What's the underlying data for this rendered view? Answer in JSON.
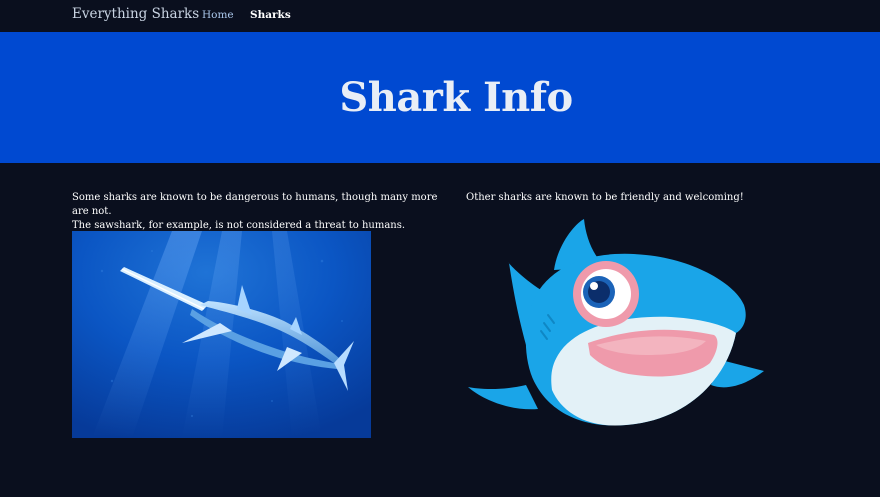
{
  "nav": {
    "brand": "Everything Sharks",
    "links": [
      {
        "label": "Home"
      },
      {
        "label": "Sharks"
      }
    ]
  },
  "hero": {
    "title": "Shark Info"
  },
  "content": {
    "left_text_line1": "Some sharks are known to be dangerous to humans, though many more are not.",
    "left_text_line2": "The sawshark, for example, is not considered a threat to humans.",
    "right_text": "Other sharks are known to be friendly and welcoming!"
  },
  "colors": {
    "page_background": "#0a0f1e",
    "hero_background": "#0049d1",
    "cartoon_shark": "#1aa5e8",
    "cartoon_belly": "#e3f1f7",
    "cartoon_mouth": "#ef9aab"
  }
}
